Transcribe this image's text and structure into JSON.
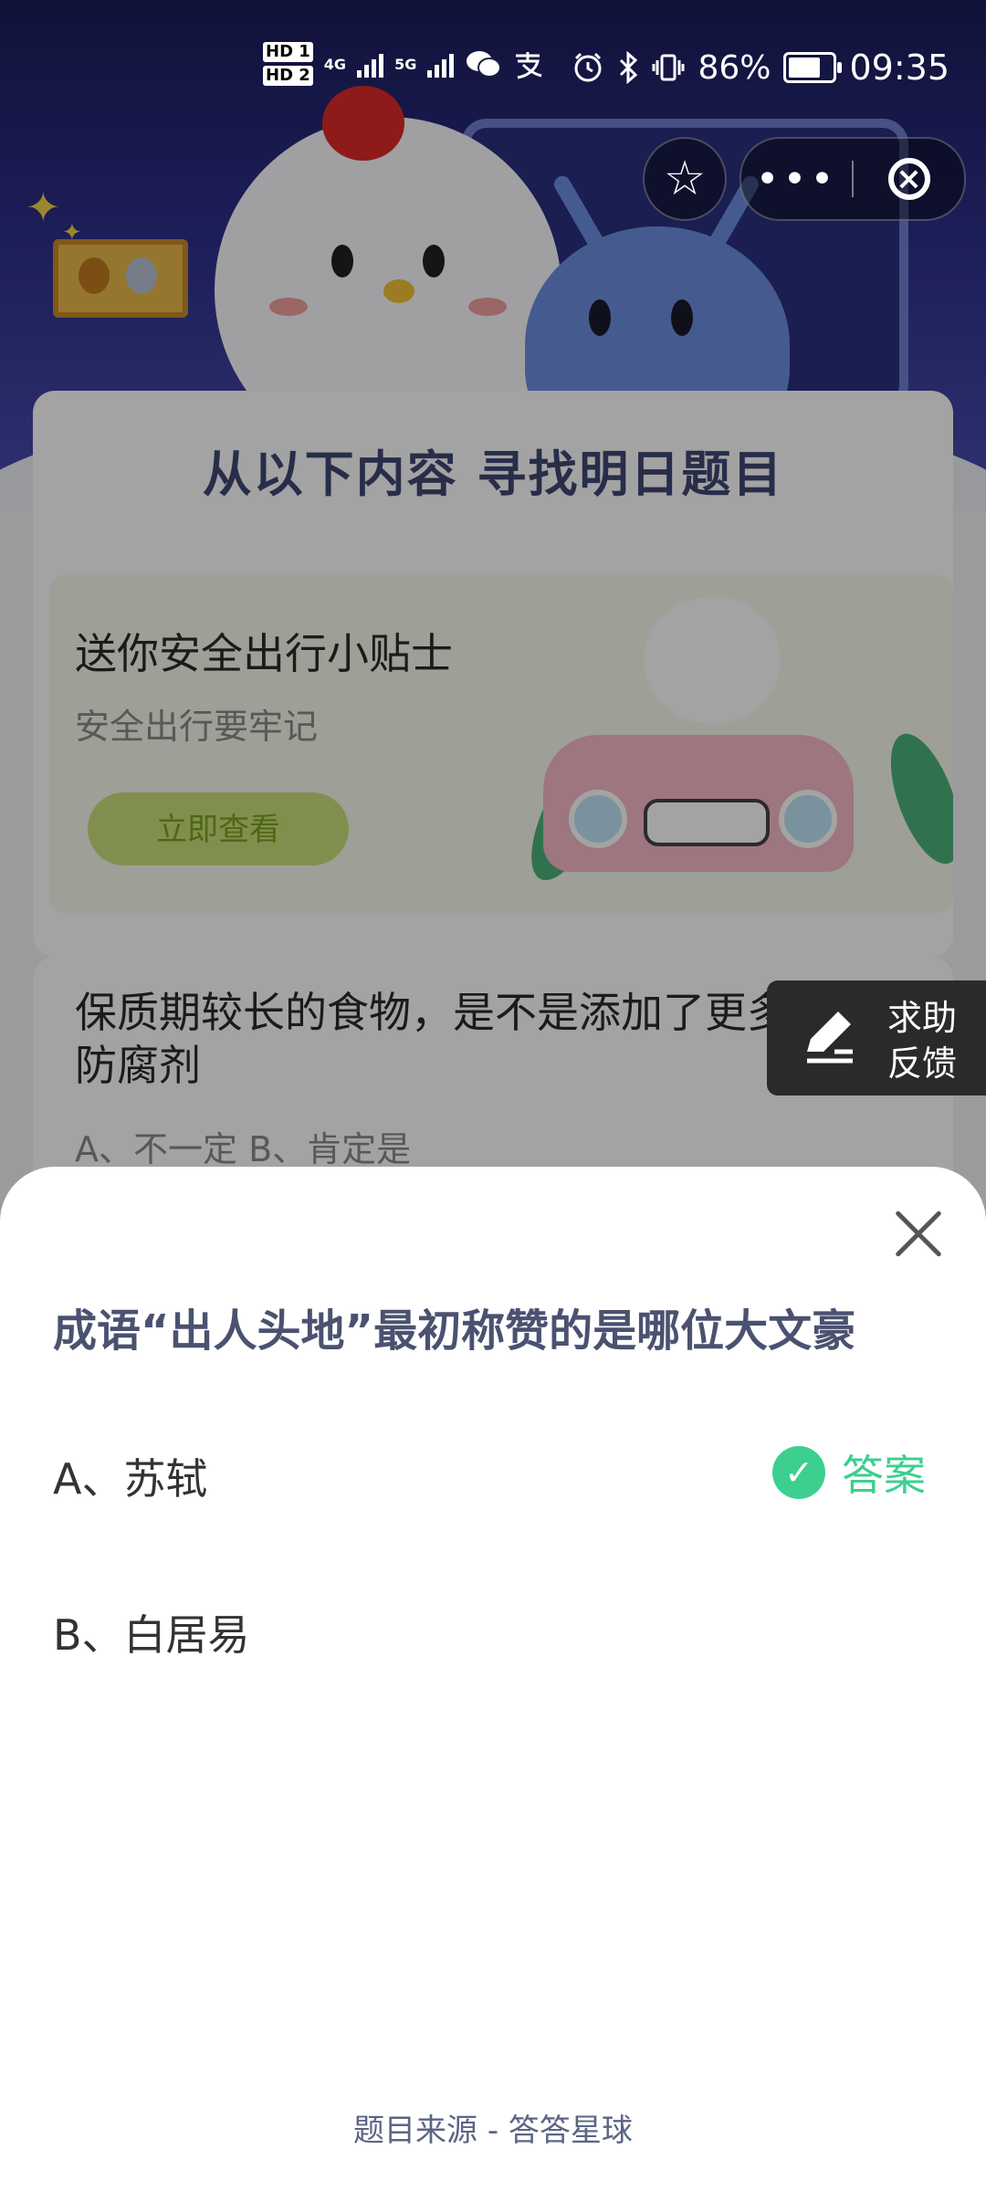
{
  "status_bar": {
    "hd1": "HD 1",
    "hd2": "HD 2",
    "net1": "4G",
    "net2": "5G",
    "battery_percent": "86%",
    "battery_level": 0.86,
    "time": "09:35",
    "icons": [
      "wechat-icon",
      "alipay-icon",
      "alarm-icon",
      "bluetooth-icon",
      "vibrate-icon"
    ]
  },
  "capsule": {
    "star_icon": "☆",
    "more_icon": "•••",
    "close_icon": "×"
  },
  "page": {
    "section_title": "从以下内容  寻找明日题目",
    "promo": {
      "title": "送你安全出行小贴士",
      "subtitle": "安全出行要牢记",
      "button": "立即查看"
    },
    "question_card": {
      "question": "保质期较长的食物，是不是添加了更多的防腐剂",
      "options": "A、不一定    B、肯定是"
    }
  },
  "feedback": {
    "line1": "求助",
    "line2": "反馈"
  },
  "sheet": {
    "question": "成语“出人头地”最初称赞的是哪位大文豪",
    "option_a": "A、苏轼",
    "option_b": "B、白居易",
    "answer_label": "答案",
    "answer_check": "✓",
    "source": "题目来源 - 答答星球",
    "accent_color": "#3ccf8e"
  }
}
